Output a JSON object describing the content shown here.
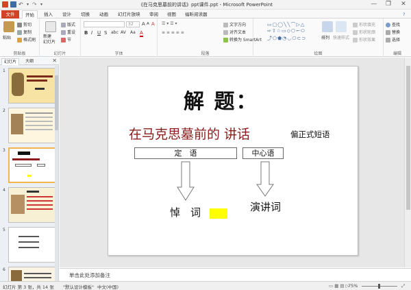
{
  "window": {
    "title": "《在马克思墓前的讲话》ppt课件.ppt - Microsoft PowerPoint",
    "controls": {
      "minimize": "—",
      "maximize": "❐",
      "close": "✕"
    }
  },
  "tabs": [
    "文件",
    "开始",
    "插入",
    "设计",
    "切换",
    "动画",
    "幻灯片放映",
    "审阅",
    "视图",
    "福昕阅读器"
  ],
  "ribbon": {
    "clipboard": {
      "paste": "粘贴",
      "cut": "剪切",
      "copy": "复制",
      "format_painter": "格式刷",
      "label": "剪贴板"
    },
    "slides": {
      "new_slide": "新建\n幻灯片",
      "layout": "版式",
      "reset": "重设",
      "section": "节",
      "label": "幻灯片"
    },
    "font": {
      "font_name": "",
      "font_size": "32",
      "bold": "B",
      "italic": "I",
      "underline": "U",
      "strike": "S",
      "shadow": "abc",
      "spacing": "AV",
      "case": "Aa",
      "color": "A",
      "grow": "A",
      "shrink": "A",
      "clear": "A",
      "label": "字体"
    },
    "paragraph": {
      "text_direction": "文字方向",
      "align_text": "对齐文本",
      "smartart": "转换为 SmartArt",
      "label": "段落"
    },
    "drawing": {
      "arrange": "排列",
      "quick_styles": "快速样式",
      "shape_fill": "形状填充",
      "shape_outline": "形状轮廓",
      "shape_effects": "形状效果",
      "label": "绘图"
    },
    "editing": {
      "find": "查找",
      "replace": "替换",
      "select": "选择",
      "label": "编辑"
    }
  },
  "pane": {
    "tab_slides": "幻灯片",
    "tab_outline": "大纲",
    "close": "✕"
  },
  "thumbnails": [
    {
      "num": "1",
      "bg": "#f7e3a4"
    },
    {
      "num": "2",
      "bg": "#fff6df"
    },
    {
      "num": "3",
      "bg": "#ffffff"
    },
    {
      "num": "4",
      "bg": "#f7f0d5"
    },
    {
      "num": "5",
      "bg": "#ffffff"
    },
    {
      "num": "6",
      "bg": "#fbf4e4"
    }
  ],
  "slide": {
    "title": "解 题：",
    "subtitle": "在马克思墓前的 讲话",
    "type_label": "偏正式短语",
    "modifier_box": "定　语",
    "head_box": "中心语",
    "left_word": "悼　词",
    "right_word": "演讲词",
    "title_color": "#111111",
    "subtitle_color": "#8b1a1a",
    "highlight_color": "#ffff00"
  },
  "notes": {
    "placeholder": "单击此处添加备注"
  },
  "status": {
    "slide_info": "幻灯片 第 3 张，共 14 张",
    "theme": "\"默认设计模板\"",
    "language": "中文(中国)",
    "zoom": "75%"
  }
}
